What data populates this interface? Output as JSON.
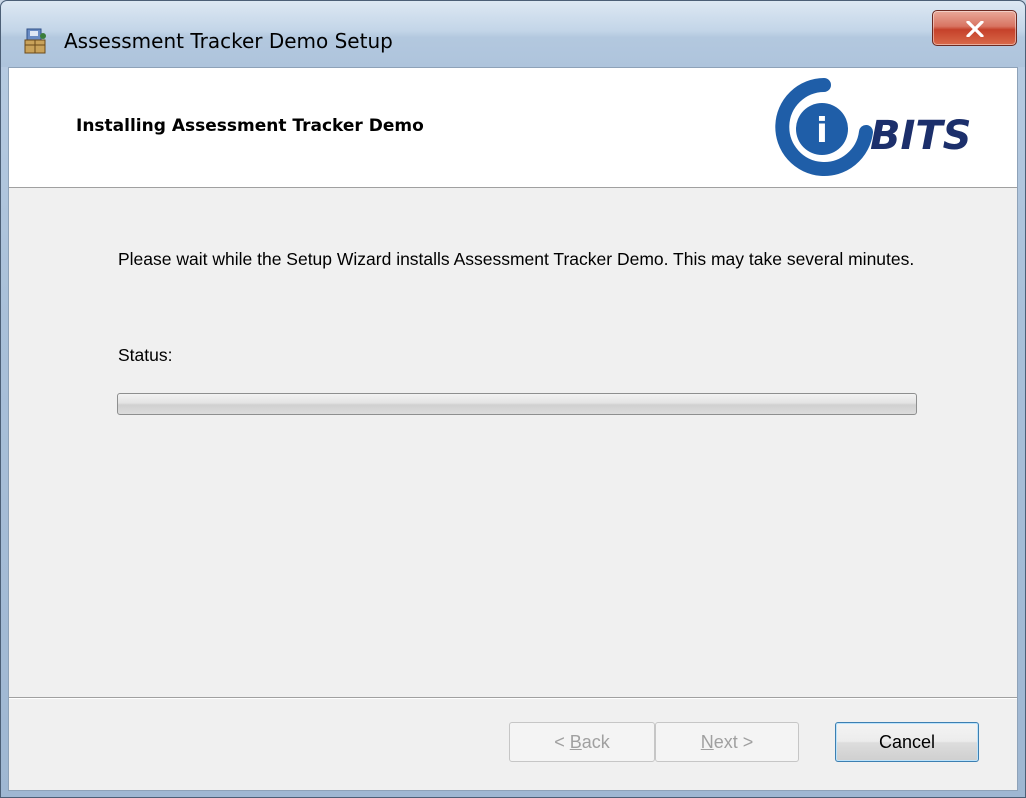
{
  "window": {
    "title": "Assessment Tracker Demo Setup",
    "icon": "installer-icon"
  },
  "banner": {
    "title": "Installing Assessment Tracker Demo",
    "logo_text": "BITS",
    "logo_letter": "i"
  },
  "body": {
    "description": "Please wait while the Setup Wizard installs Assessment Tracker Demo.  This may take several minutes.",
    "status_label": "Status:"
  },
  "progress": {
    "value_percent": 0
  },
  "buttons": {
    "back": {
      "prefix": "< ",
      "hotkey": "B",
      "rest": "ack",
      "enabled": false
    },
    "next": {
      "prefix": "",
      "hotkey": "N",
      "rest": "ext >",
      "enabled": false
    },
    "cancel": {
      "label": "Cancel",
      "enabled": true
    }
  },
  "colors": {
    "logo_blue": "#1f5ea8",
    "logo_navy": "#1c2f6b",
    "close_red": "#c5412a"
  }
}
